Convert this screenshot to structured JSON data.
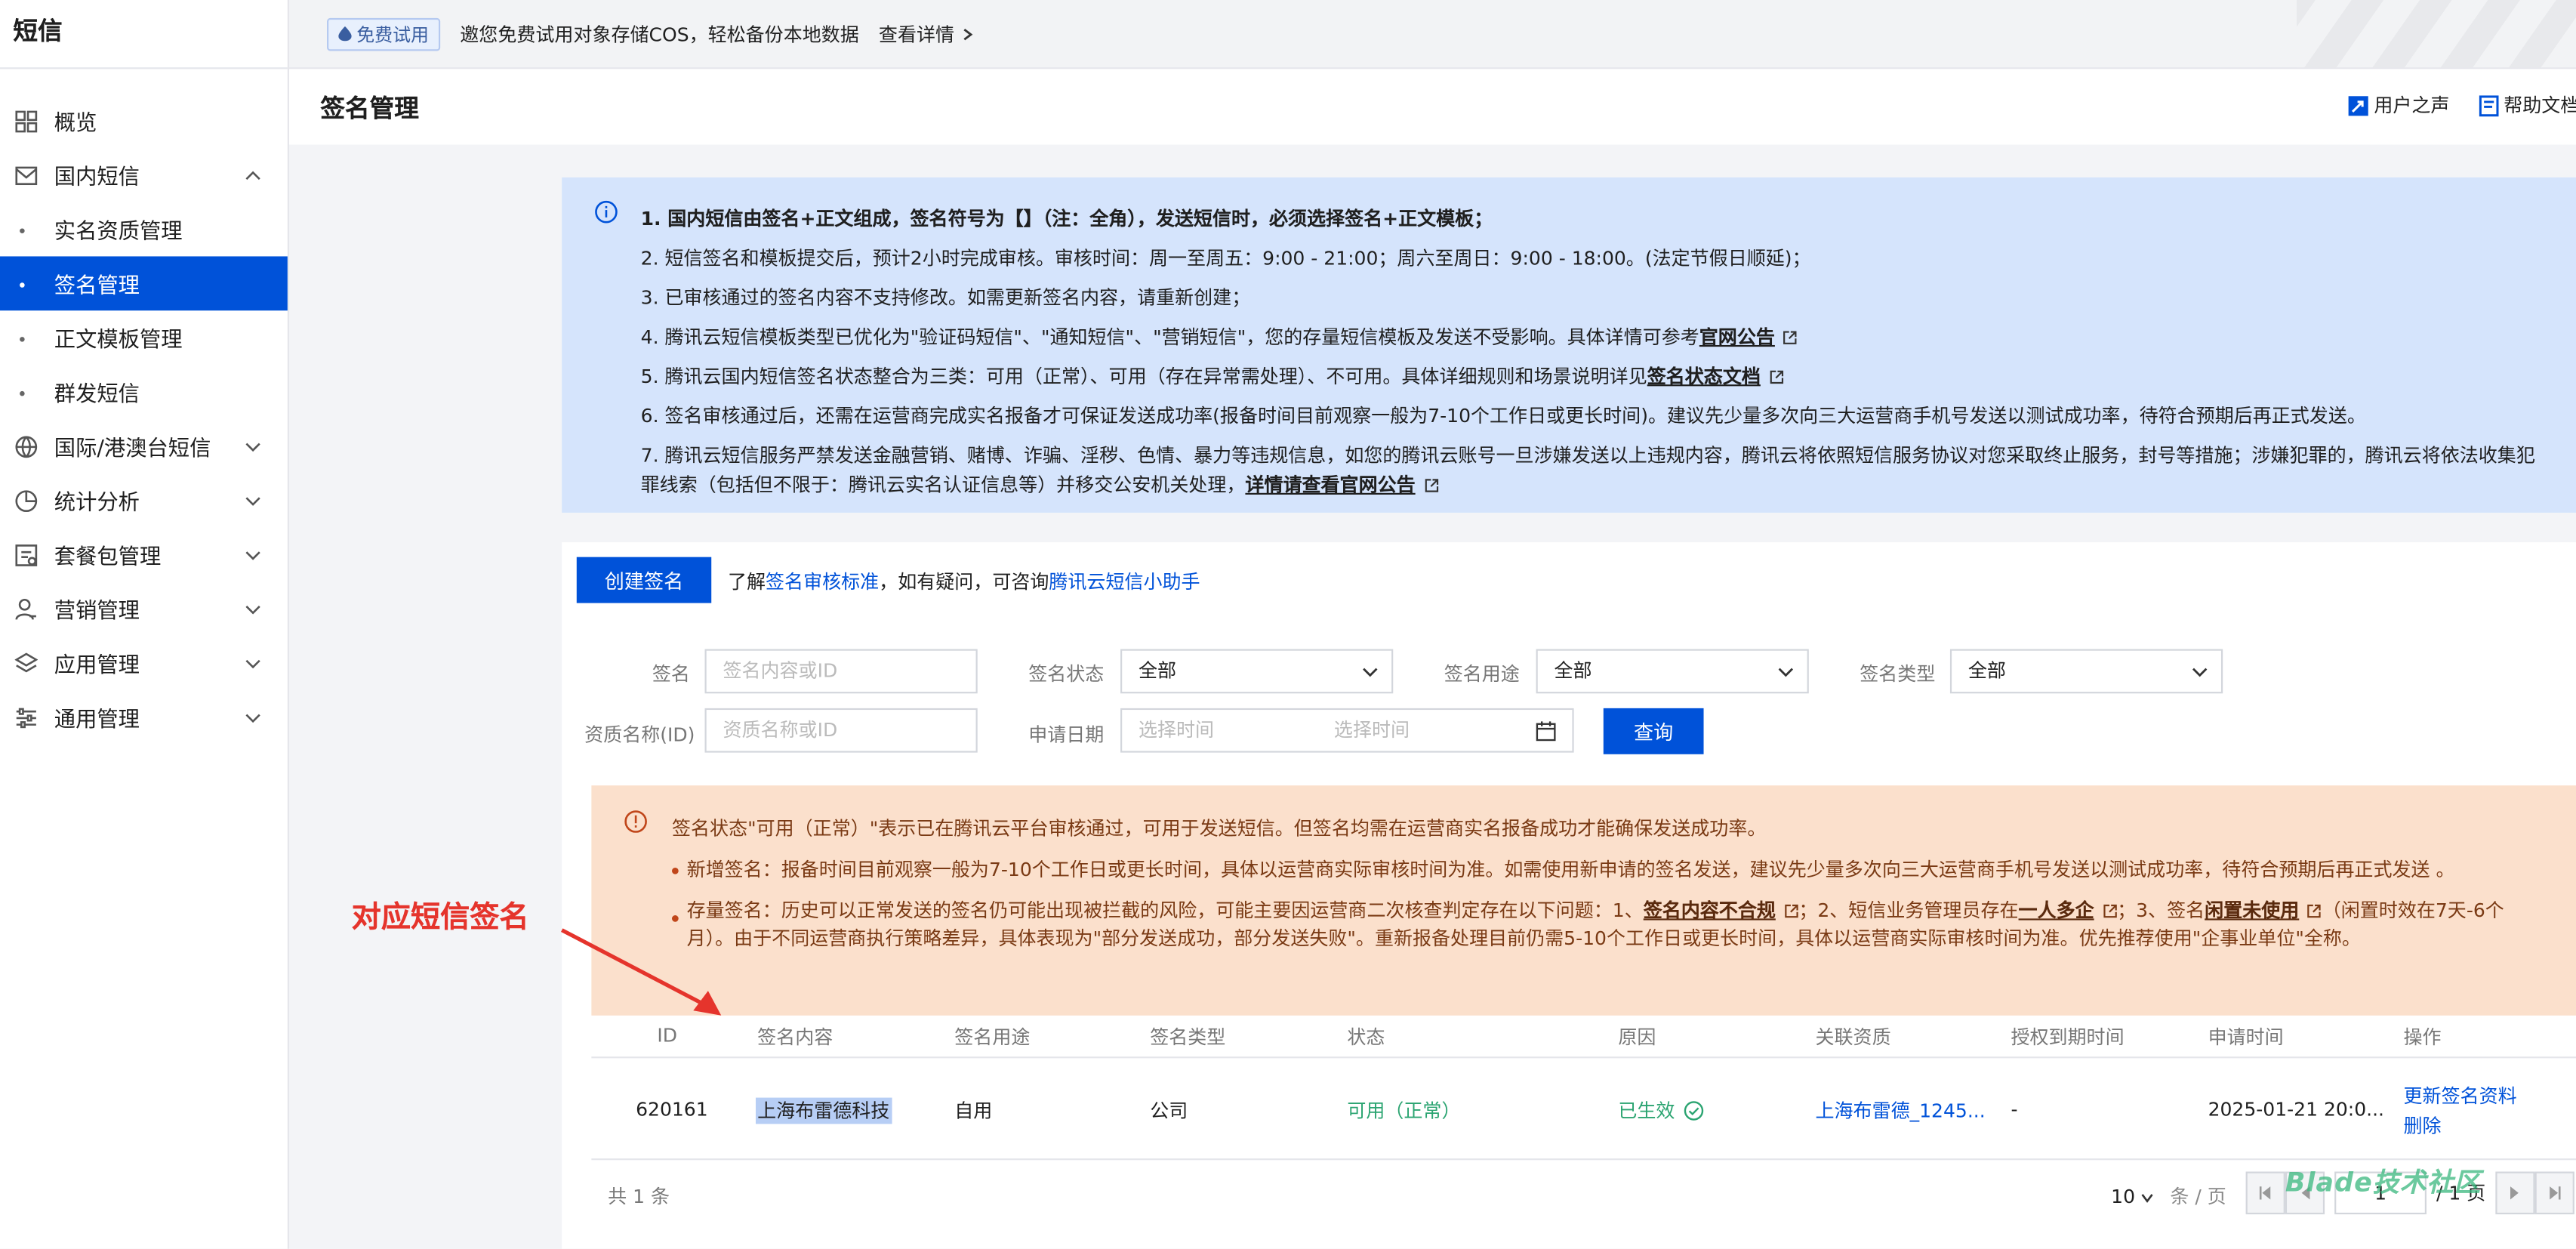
{
  "app": {
    "title": "短信"
  },
  "sidebar": {
    "items": [
      {
        "label": "概览",
        "icon": "grid-icon"
      },
      {
        "label": "国内短信",
        "icon": "mail-icon",
        "expanded": true
      },
      {
        "label": "实名资质管理",
        "sub": true
      },
      {
        "label": "签名管理",
        "sub": true,
        "active": true
      },
      {
        "label": "正文模板管理",
        "sub": true
      },
      {
        "label": "群发短信",
        "sub": true
      },
      {
        "label": "国际/港澳台短信",
        "icon": "globe-icon"
      },
      {
        "label": "统计分析",
        "icon": "pie-chart-icon"
      },
      {
        "label": "套餐包管理",
        "icon": "package-icon"
      },
      {
        "label": "营销管理",
        "icon": "user-manage-icon"
      },
      {
        "label": "应用管理",
        "icon": "layers-icon"
      },
      {
        "label": "通用管理",
        "icon": "sliders-icon"
      }
    ]
  },
  "topbar": {
    "badge": "免费试用",
    "text": "邀您免费试用对象存储COS，轻松备份本地数据",
    "link": "查看详情"
  },
  "header": {
    "title": "签名管理",
    "user_voice": "用户之声",
    "help_docs": "帮助文档"
  },
  "notice": {
    "l1": "1. 国内短信由签名+正文组成，签名符号为【】（注：全角），发送短信时，必须选择签名+正文模板；",
    "l2": "2. 短信签名和模板提交后，预计2小时完成审核。审核时间：周一至周五：9:00 - 21:00；周六至周日：9:00 - 18:00。(法定节假日顺延)；",
    "l3": "3. 已审核通过的签名内容不支持修改。如需更新签名内容，请重新创建；",
    "l4": "4. 腾讯云短信模板类型已优化为\"验证码短信\"、\"通知短信\"、\"营销短信\"，您的存量短信模板及发送不受影响。具体详情可参考",
    "l4_link": "官网公告",
    "l5": "5. 腾讯云国内短信签名状态整合为三类：可用（正常）、可用（存在异常需处理）、不可用。具体详细规则和场景说明详见",
    "l5_link": "签名状态文档",
    "l6": "6. 签名审核通过后，还需在运营商完成实名报备才可保证发送成功率(报备时间目前观察一般为7-10个工作日或更长时间)。建议先少量多次向三大运营商手机号发送以测试成功率，待符合预期后再正式发送。",
    "l7": "7. 腾讯云短信服务严禁发送金融营销、赌博、诈骗、淫秽、色情、暴力等违规信息，如您的腾讯云账号一旦涉嫌发送以上违规内容，腾讯云将依照短信服务协议对您采取终止服务，封号等措施；涉嫌犯罪的，腾讯云将依法收集犯罪线索（包括但不限于：腾讯云实名认证信息等）并移交公安机关处理，",
    "l7_link": "详情请查看官网公告"
  },
  "toolbar": {
    "create_label": "创建签名",
    "guide_prefix": "了解",
    "guide_link1": "签名审核标准",
    "guide_mid": "，如有疑问，可咨询",
    "guide_link2": "腾讯云短信小助手"
  },
  "filters": {
    "sign_label": "签名",
    "sign_placeholder": "签名内容或ID",
    "status_label": "签名状态",
    "status_value": "全部",
    "usage_label": "签名用途",
    "usage_value": "全部",
    "type_label": "签名类型",
    "type_value": "全部",
    "qual_label": "资质名称(ID)",
    "qual_placeholder": "资质名称或ID",
    "date_label": "申请日期",
    "date_start": "选择时间",
    "date_end": "选择时间",
    "query_label": "查询"
  },
  "warning": {
    "main": "签名状态\"可用（正常）\"表示已在腾讯云平台审核通过，可用于发送短信。但签名均需在运营商实名报备成功才能确保发送成功率。",
    "b1": "新增签名：报备时间目前观察一般为7-10个工作日或更长时间，具体以运营商实际审核时间为准。如需使用新申请的签名发送，建议先少量多次向三大运营商手机号发送以测试成功率，待符合预期后再正式发送 。",
    "b2_p1": "存量签名：历史可以正常发送的签名仍可能出现被拦截的风险，可能主要因运营商二次核查判定存在以下问题：1、",
    "b2_link1": "签名内容不合规",
    "b2_p2": "；2、短信业务管理员存在",
    "b2_link2": "一人多企",
    "b2_p3": "；3、签名",
    "b2_link3": "闲置未使用",
    "b2_p4": "（闲置时效在7天-6个月）。由于不同运营商执行策略差异，具体表现为\"部分发送成功，部分发送失败\"。重新报备处理目前仍需5-10个工作日或更长时间，具体以运营商实际审核时间为准。优先推荐使用\"企事业单位\"全称。"
  },
  "annotation": "对应短信签名",
  "table": {
    "headers": [
      "ID",
      "签名内容",
      "签名用途",
      "签名类型",
      "状态",
      "原因",
      "关联资质",
      "授权到期时间",
      "申请时间",
      "操作"
    ],
    "rows": [
      {
        "id": "620161",
        "content": "上海布雷德科技",
        "usage": "自用",
        "type": "公司",
        "status": "可用（正常）",
        "reason": "已生效",
        "qualification": "上海布雷德_1245...",
        "expire": "-",
        "apply_time": "2025-01-21 20:0...",
        "action1": "更新签名资料",
        "action2": "删除"
      }
    ]
  },
  "footer": {
    "total": "共 1 条",
    "page_size": "10",
    "page_size_unit": "条 / 页",
    "page_current": "1",
    "page_total": "/ 1 页"
  },
  "watermark": "Blade技术社区",
  "colors": {
    "primary": "#0052d9",
    "success": "#2ba471",
    "notice_bg": "#d5e4fc",
    "warning_bg": "#fbe0cc",
    "annotation": "#e5342c"
  }
}
